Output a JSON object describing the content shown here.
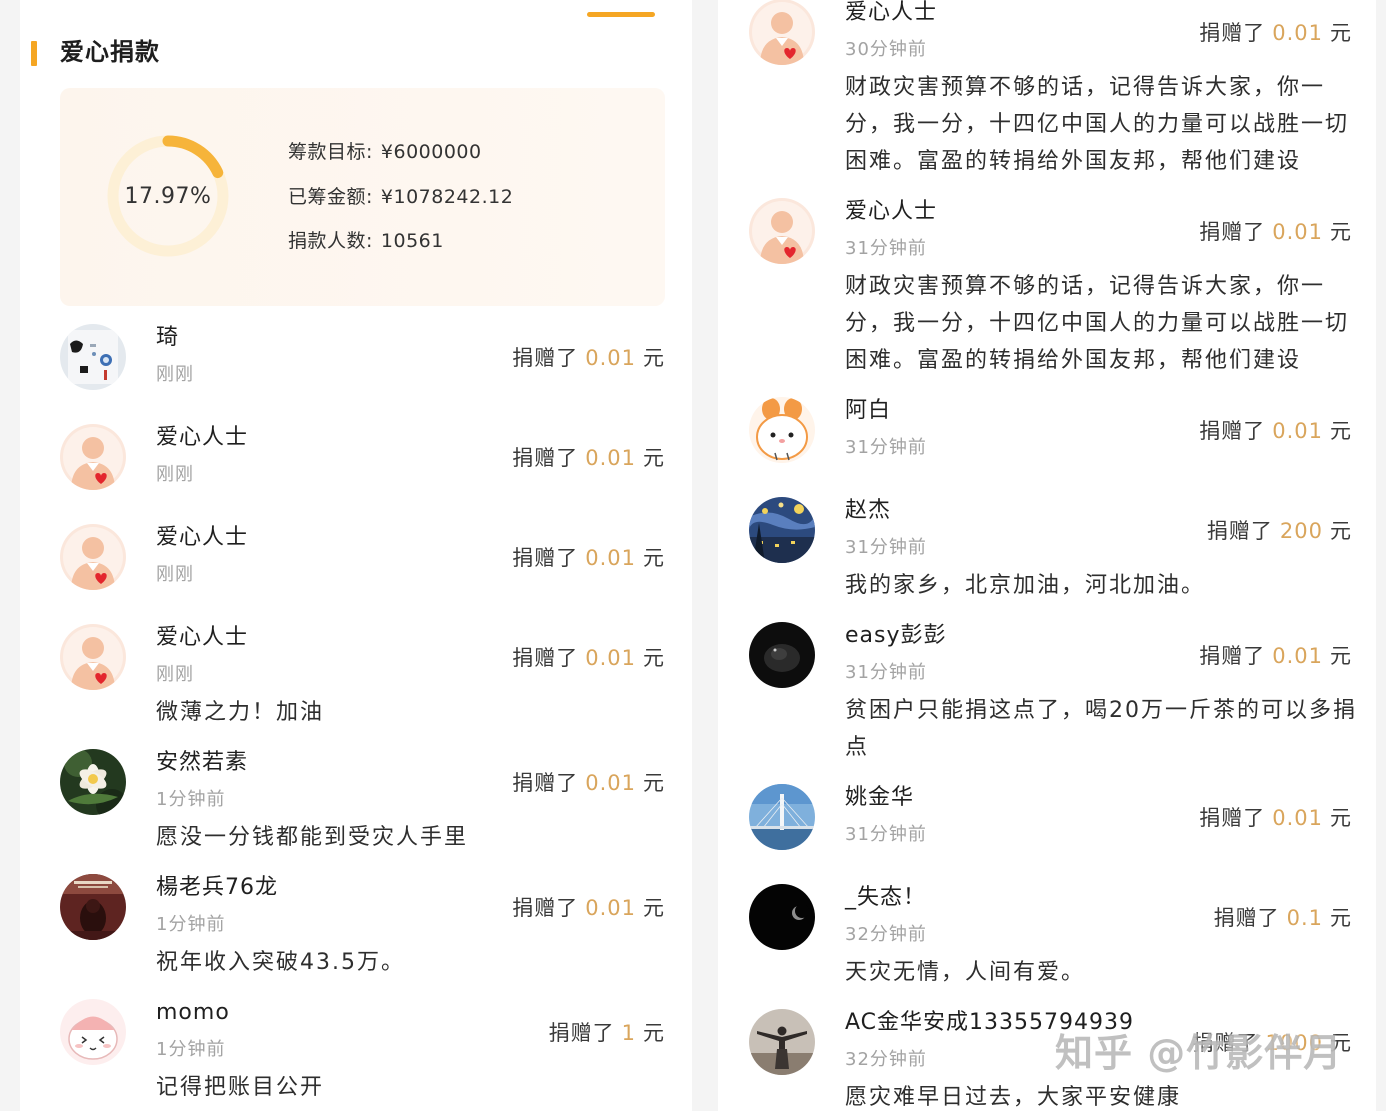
{
  "colors": {
    "accent": "#f5a623",
    "ring_arc": "#f6b43a",
    "ring_track": "#fdf0d6",
    "amount": "#d9a55c"
  },
  "left_panel": {
    "section_title": "爱心捐款",
    "summary": {
      "progress_text": "17.97%",
      "progress": 0.1797,
      "goal_label": "筹款目标:",
      "goal_value": "¥6000000",
      "raised_label": "已筹金额:",
      "raised_value": "¥1078242.12",
      "donors_label": "捐款人数:",
      "donors_value": "10561"
    },
    "donations": [
      {
        "avatar": "photo-avatar",
        "name": "琦",
        "time": "刚刚",
        "amount": "0.01"
      },
      {
        "avatar": "default-heart-avatar",
        "name": "爱心人士",
        "time": "刚刚",
        "amount": "0.01"
      },
      {
        "avatar": "default-heart-avatar",
        "name": "爱心人士",
        "time": "刚刚",
        "amount": "0.01"
      },
      {
        "avatar": "default-heart-avatar",
        "name": "爱心人士",
        "time": "刚刚",
        "amount": "0.01",
        "comment": "微薄之力！加油"
      },
      {
        "avatar": "flower-avatar",
        "name": "安然若素",
        "time": "1分钟前",
        "amount": "0.01",
        "comment": "愿没一分钱都能到受灾人手里"
      },
      {
        "avatar": "dark-red-avatar",
        "name": "楊老兵76龙",
        "time": "1分钟前",
        "amount": "0.01",
        "comment": "祝年收入突破43.5万。"
      },
      {
        "avatar": "cartoon-pink-avatar",
        "name": "momo",
        "time": "1分钟前",
        "amount": "1",
        "comment": "记得把账目公开"
      }
    ]
  },
  "right_panel": {
    "donations": [
      {
        "avatar": "default-heart-avatar",
        "name": "爱心人士",
        "time": "30分钟前",
        "amount": "0.01",
        "comment": "财政灾害预算不够的话，记得告诉大家，你一分，我一分，十四亿中国人的力量可以战胜一切困难。富盈的转捐给外国友邦，帮他们建设"
      },
      {
        "avatar": "default-heart-avatar",
        "name": "爱心人士",
        "time": "31分钟前",
        "amount": "0.01",
        "comment": "财政灾害预算不够的话，记得告诉大家，你一分，我一分，十四亿中国人的力量可以战胜一切困难。富盈的转捐给外国友邦，帮他们建设"
      },
      {
        "avatar": "cartoon-bunny-avatar",
        "name": "阿白",
        "time": "31分钟前",
        "amount": "0.01"
      },
      {
        "avatar": "night-painting-avatar",
        "name": "赵杰",
        "time": "31分钟前",
        "amount": "200",
        "comment": "我的家乡，北京加油，河北加油。"
      },
      {
        "avatar": "dark-avatar",
        "name": "easy彭彭",
        "time": "31分钟前",
        "amount": "0.01",
        "comment": "贫困户只能捐这点了，喝20万一斤茶的可以多捐点"
      },
      {
        "avatar": "bridge-avatar",
        "name": "姚金华",
        "time": "31分钟前",
        "amount": "0.01"
      },
      {
        "avatar": "moon-avatar",
        "name": "_失态！",
        "time": "32分钟前",
        "amount": "0.1",
        "comment": "天灾无情，人间有爱。"
      },
      {
        "avatar": "portrait-avatar",
        "name": "AC金华安成13355794939",
        "time": "32分钟前",
        "amount": "1000",
        "comment": "愿灾难早日过去，大家平安健康"
      }
    ]
  },
  "donation_labels": {
    "prefix": "捐赠了",
    "unit": "元"
  },
  "watermark": "知乎 @竹影伴月"
}
